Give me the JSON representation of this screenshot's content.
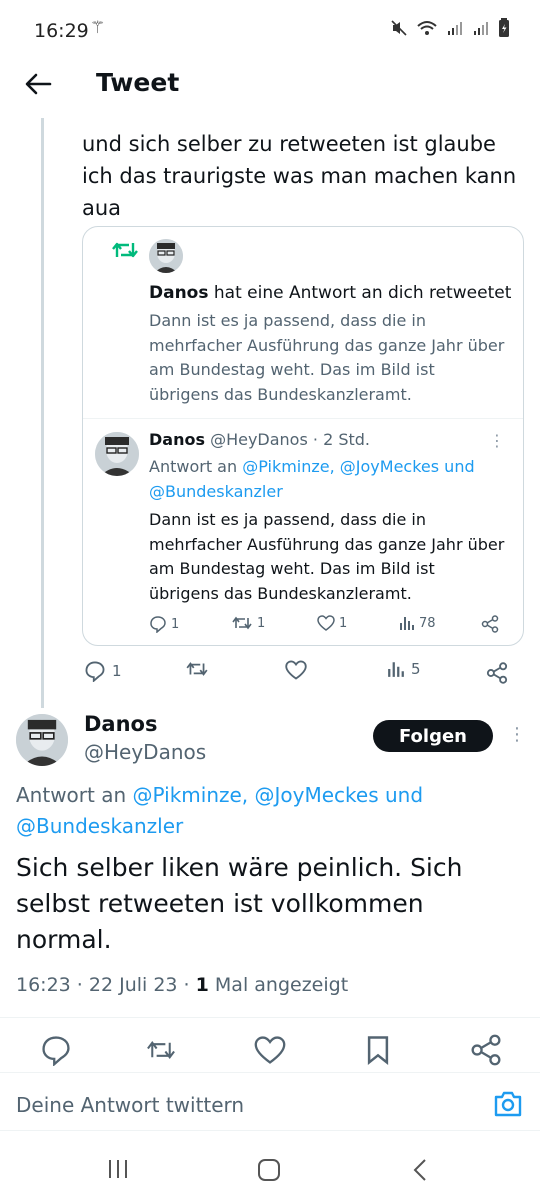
{
  "status": {
    "time": "16:29"
  },
  "header": {
    "title": "Tweet"
  },
  "parent": {
    "text": "und sich selber zu retweeten ist glaube ich das traurigste was man machen kann aua",
    "replies": "1",
    "views": "5"
  },
  "card": {
    "retweet_user": "Danos",
    "retweet_action": " hat eine Antwort an dich retweetet",
    "retweet_text": "Dann ist es ja passend, dass die in mehrfacher Ausführung das ganze Jahr über am Bundestag weht. Das im Bild ist übrigens das Bundeskanzleramt.",
    "quoted": {
      "name": "Danos",
      "handle_time": " @HeyDanos · 2 Std.",
      "reply_prefix": "Antwort an ",
      "reply_mentions": "@Pikminze, @JoyMeckes und @Bundeskanzler",
      "text": "Dann ist es ja passend, dass die in mehrfacher Ausführung das ganze Jahr über am Bundestag weht. Das im Bild ist übrigens das Bundeskanzleramt.",
      "replies": "1",
      "retweets": "1",
      "likes": "1",
      "views": "78"
    }
  },
  "reply": {
    "name": "Danos",
    "handle": "@HeyDanos",
    "follow_label": "Folgen",
    "reply_prefix": "Antwort an ",
    "reply_mentions_1": "@Pikminze, @JoyMeckes und",
    "reply_mentions_2": "@Bundeskanzler",
    "text": "Sich selber liken wäre peinlich. Sich selbst retweeten ist vollkommen normal.",
    "meta_time": "16:23 · 22 Juli 23 · ",
    "meta_views_count": "1",
    "meta_views_label": " Mal angezeigt"
  },
  "composer": {
    "placeholder": "Deine Antwort twittern"
  },
  "colors": {
    "accent": "#1d9bf0",
    "retweet_green": "#00ba7c",
    "text": "#0f1419",
    "secondary": "#536471"
  },
  "icons": [
    "back-arrow-icon",
    "retweet-icon",
    "reply-icon",
    "like-icon",
    "views-icon",
    "share-icon",
    "bookmark-icon",
    "camera-icon",
    "more-icon"
  ]
}
